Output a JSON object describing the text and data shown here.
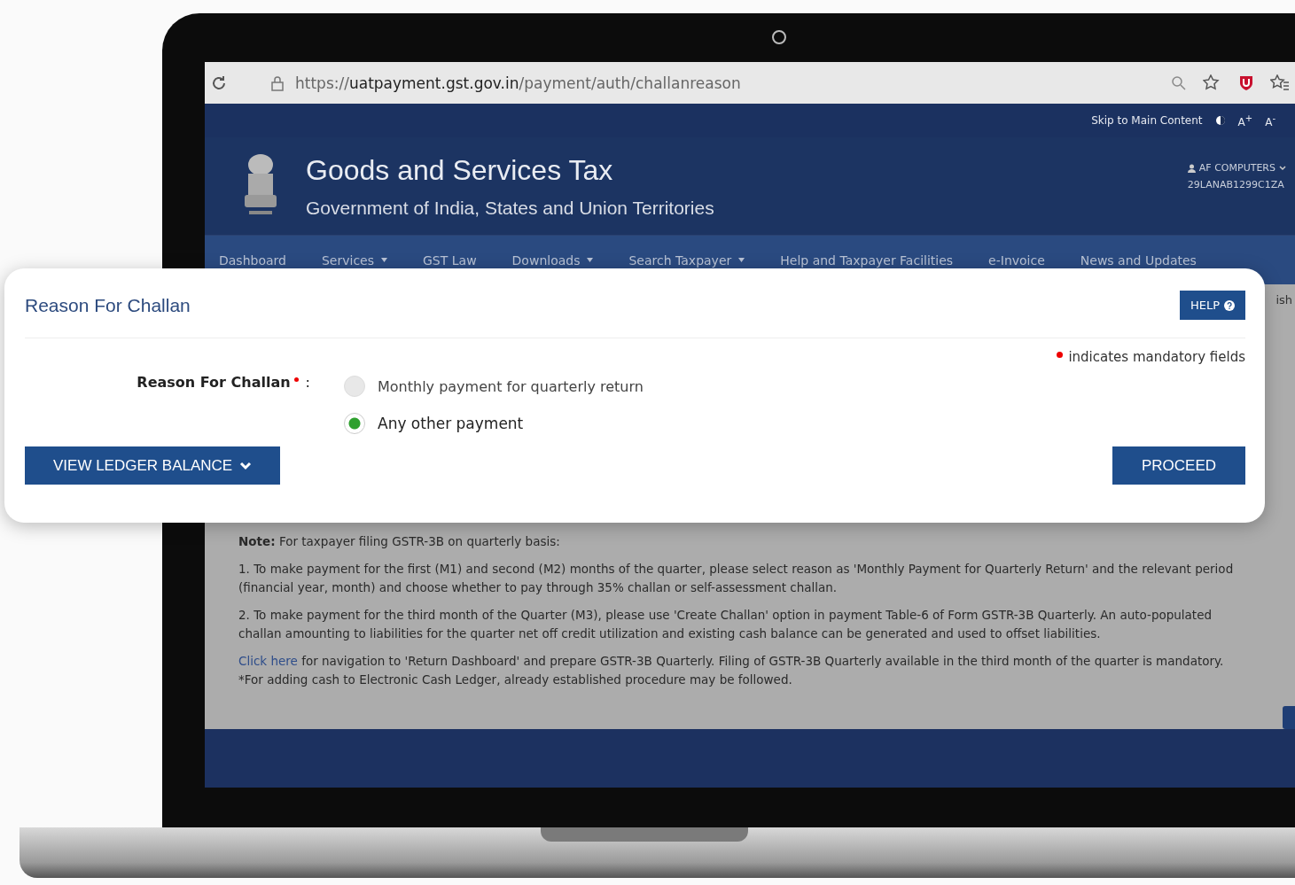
{
  "browser": {
    "url": "https://**uatpayment.gst.gov.in**/payment/auth/challanreason"
  },
  "top_strip": {
    "skip_link": "Skip to Main Content",
    "font_increase": "A$^{+}$",
    "font_decrease": "A$^{-}$"
  },
  "header": {
    "title": "Goods and Services Tax",
    "subtitle": "Government of India, States and Union Territories",
    "user_name": "AF COMPUTERS",
    "gstin": "29LANAB1299C1ZA"
  },
  "nav": [
    {
      "label": "Dashboard",
      "dropdown": false
    },
    {
      "label": "Services",
      "dropdown": true
    },
    {
      "label": "GST Law",
      "dropdown": false
    },
    {
      "label": "Downloads",
      "dropdown": true
    },
    {
      "label": "Search Taxpayer",
      "dropdown": true
    },
    {
      "label": "Help and Taxpayer Facilities",
      "dropdown": false
    },
    {
      "label": "e-Invoice",
      "dropdown": false
    },
    {
      "label": "News and Updates",
      "dropdown": false
    }
  ],
  "background_text": "ish",
  "dialog": {
    "title": "Reason For Challan",
    "help_button": "HELP",
    "mandatory_note": "indicates mandatory fields",
    "field_label": "Reason For Challan",
    "field_colon": ":",
    "options": [
      {
        "label": "Monthly payment for quarterly return",
        "selected": false
      },
      {
        "label": "Any other payment",
        "selected": true
      }
    ],
    "ledger_button": "VIEW LEDGER BALANCE",
    "proceed_button": "PROCEED"
  },
  "note": {
    "heading": "Note:",
    "intro": "For taxpayer filing GSTR-3B on quarterly basis:",
    "points": [
      "1. To make payment for the first (M1) and second (M2) months of the quarter, please select reason as 'Monthly Payment for Quarterly Return' and the relevant period (financial year, month) and choose whether to pay through 35% challan or self-assessment challan.",
      "2. To make payment for the third month of the Quarter (M3), please use 'Create Challan' option in payment Table-6 of Form GSTR-3B Quarterly. An auto-populated challan amounting to liabilities for the quarter net off credit utilization and existing cash balance can be generated and used to offset liabilities."
    ],
    "link": "Click here",
    "link_text": "for navigation to 'Return Dashboard' and prepare GSTR-3B Quarterly. Filing of GSTR-3B Quarterly available in the third month of the quarter is mandatory.",
    "footnote": "*For adding cash to Electronic Cash Ledger, already established procedure may be followed."
  }
}
